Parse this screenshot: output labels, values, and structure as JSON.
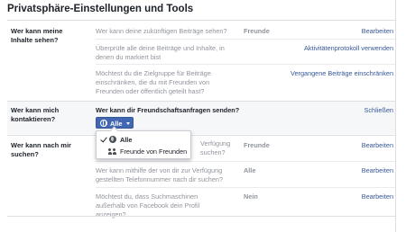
{
  "header": {
    "title": "Privatsphäre-Einstellungen und Tools"
  },
  "sections": {
    "activity": {
      "label": "Wer kann meine Inhalte sehen?",
      "rows": [
        {
          "question": "Wer kann deine zukünftigen Beiträge sehen?",
          "value": "Freunde",
          "action": "Bearbeiten"
        },
        {
          "question": "Überprüfe alle deine Beiträge und Inhalte, in denen du markiert bist",
          "value": "",
          "action": "Aktivitätenprotokoll verwenden"
        },
        {
          "question": "Möchtest du die Zielgruppe für Beiträge einschränken, die du mit Freunden von Freunden oder öffentlich geteilt hast?",
          "value": "",
          "action": "Vergangene Beiträge einschränken"
        }
      ]
    },
    "contact": {
      "label": "Wer kann mich kontaktieren?",
      "question": "Wer kann dir Freundschaftsanfragen senden?",
      "action": "Schließen",
      "audience_button": "Alle",
      "menu": [
        {
          "label": "Alle",
          "icon": "globe-icon",
          "selected": true
        },
        {
          "label": "Freunde von Freunden",
          "icon": "friends-icon",
          "selected": false
        }
      ]
    },
    "lookup": {
      "label": "Wer kann nach mir suchen?",
      "rows": [
        {
          "question": "Wer kann mithilfe der von dir zur Verfügung gestellten E-Mail-Adresse nach dir suchen?",
          "question_visible": "Verfügung",
          "question_visible_2": "suchen?",
          "value": "Freunde",
          "action": "Bearbeiten"
        },
        {
          "question": "Wer kann mithilfe der von dir zur Verfügung gestellten Telefonnummer nach dir suchen?",
          "value": "Alle",
          "action": "Bearbeiten"
        },
        {
          "question": "Möchtest du, dass Suchmaschinen außerhalb von Facebook dein Profil anzeigen?",
          "value": "Nein",
          "action": "Bearbeiten"
        }
      ]
    }
  },
  "colors": {
    "link": "#365899",
    "button": "#4267b2",
    "muted": "#90949c",
    "divider": "#dddfe2"
  }
}
